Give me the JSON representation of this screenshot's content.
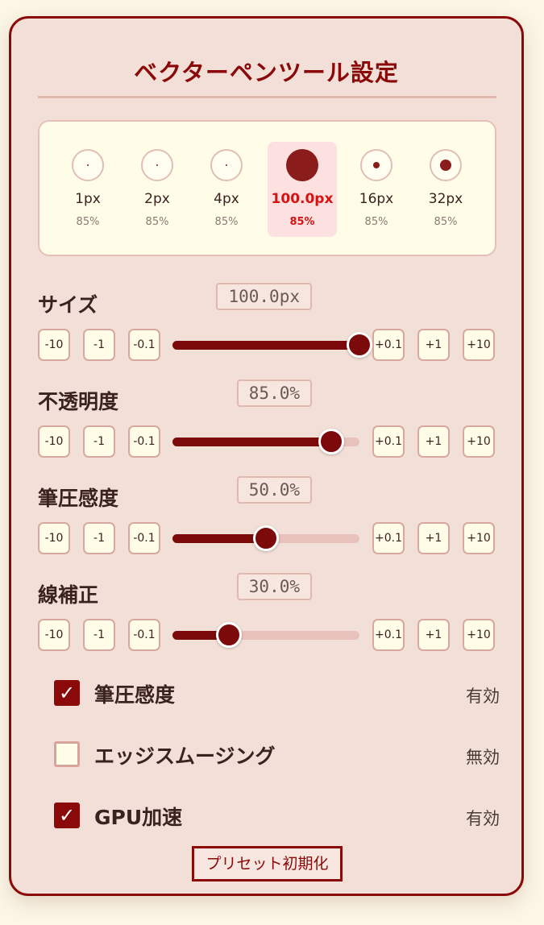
{
  "panel": {
    "title": "ベクターペンツール設定"
  },
  "presets": [
    {
      "label": "1px",
      "opacity": "85%",
      "active": false,
      "dot": 2
    },
    {
      "label": "2px",
      "opacity": "85%",
      "active": false,
      "dot": 2
    },
    {
      "label": "4px",
      "opacity": "85%",
      "active": false,
      "dot": 2
    },
    {
      "label": "100.0px",
      "opacity": "85%",
      "active": true,
      "dot": 38
    },
    {
      "label": "16px",
      "opacity": "85%",
      "active": false,
      "dot": 8
    },
    {
      "label": "32px",
      "opacity": "85%",
      "active": false,
      "dot": 14
    }
  ],
  "step_labels": [
    "-10",
    "-1",
    "-0.1",
    "+0.1",
    "+1",
    "+10"
  ],
  "sliders": [
    {
      "id": "size",
      "label": "サイズ",
      "value": "100.0px",
      "fraction": 1.0
    },
    {
      "id": "opacity",
      "label": "不透明度",
      "value": "85.0%",
      "fraction": 0.85
    },
    {
      "id": "pressure",
      "label": "筆圧感度",
      "value": "50.0%",
      "fraction": 0.5
    },
    {
      "id": "smoothing",
      "label": "線補正",
      "value": "30.0%",
      "fraction": 0.3
    }
  ],
  "toggles": [
    {
      "id": "pressure-toggle",
      "label": "筆圧感度",
      "status": "有効",
      "checked": true
    },
    {
      "id": "edge-smoothing-toggle",
      "label": "エッジスムージング",
      "status": "無効",
      "checked": false
    },
    {
      "id": "gpu-toggle",
      "label": "GPU加速",
      "status": "有効",
      "checked": true
    }
  ],
  "reset_label": "プリセット初期化",
  "check_glyph": "✓",
  "colors": {
    "accent": "#8a0a0a",
    "active_text": "#d41414",
    "panel_bg": "#f2e0d8"
  }
}
